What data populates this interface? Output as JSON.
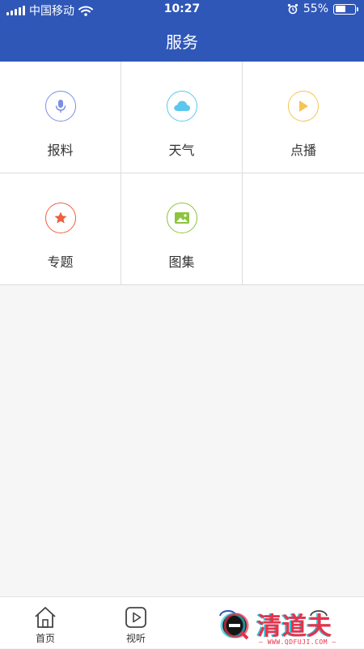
{
  "status_bar": {
    "carrier": "中国移动",
    "time": "10:27",
    "battery": "55%",
    "battery_level": 0.55
  },
  "nav": {
    "title": "服务"
  },
  "services": [
    {
      "label": "报料",
      "icon": "microphone-icon",
      "color": "#7b8ee6"
    },
    {
      "label": "天气",
      "icon": "cloud-icon",
      "color": "#5ac8ee"
    },
    {
      "label": "点播",
      "icon": "play-icon",
      "color": "#f5c451"
    },
    {
      "label": "专题",
      "icon": "star-icon",
      "color": "#ee5e3f"
    },
    {
      "label": "图集",
      "icon": "image-icon",
      "color": "#8cc43e"
    }
  ],
  "tabs": [
    {
      "label": "首页",
      "icon": "home-icon"
    },
    {
      "label": "视听",
      "icon": "play-box-icon"
    }
  ],
  "watermark": {
    "text": "清道夫",
    "sub": "— WWW.QDFUJI.COM —"
  }
}
